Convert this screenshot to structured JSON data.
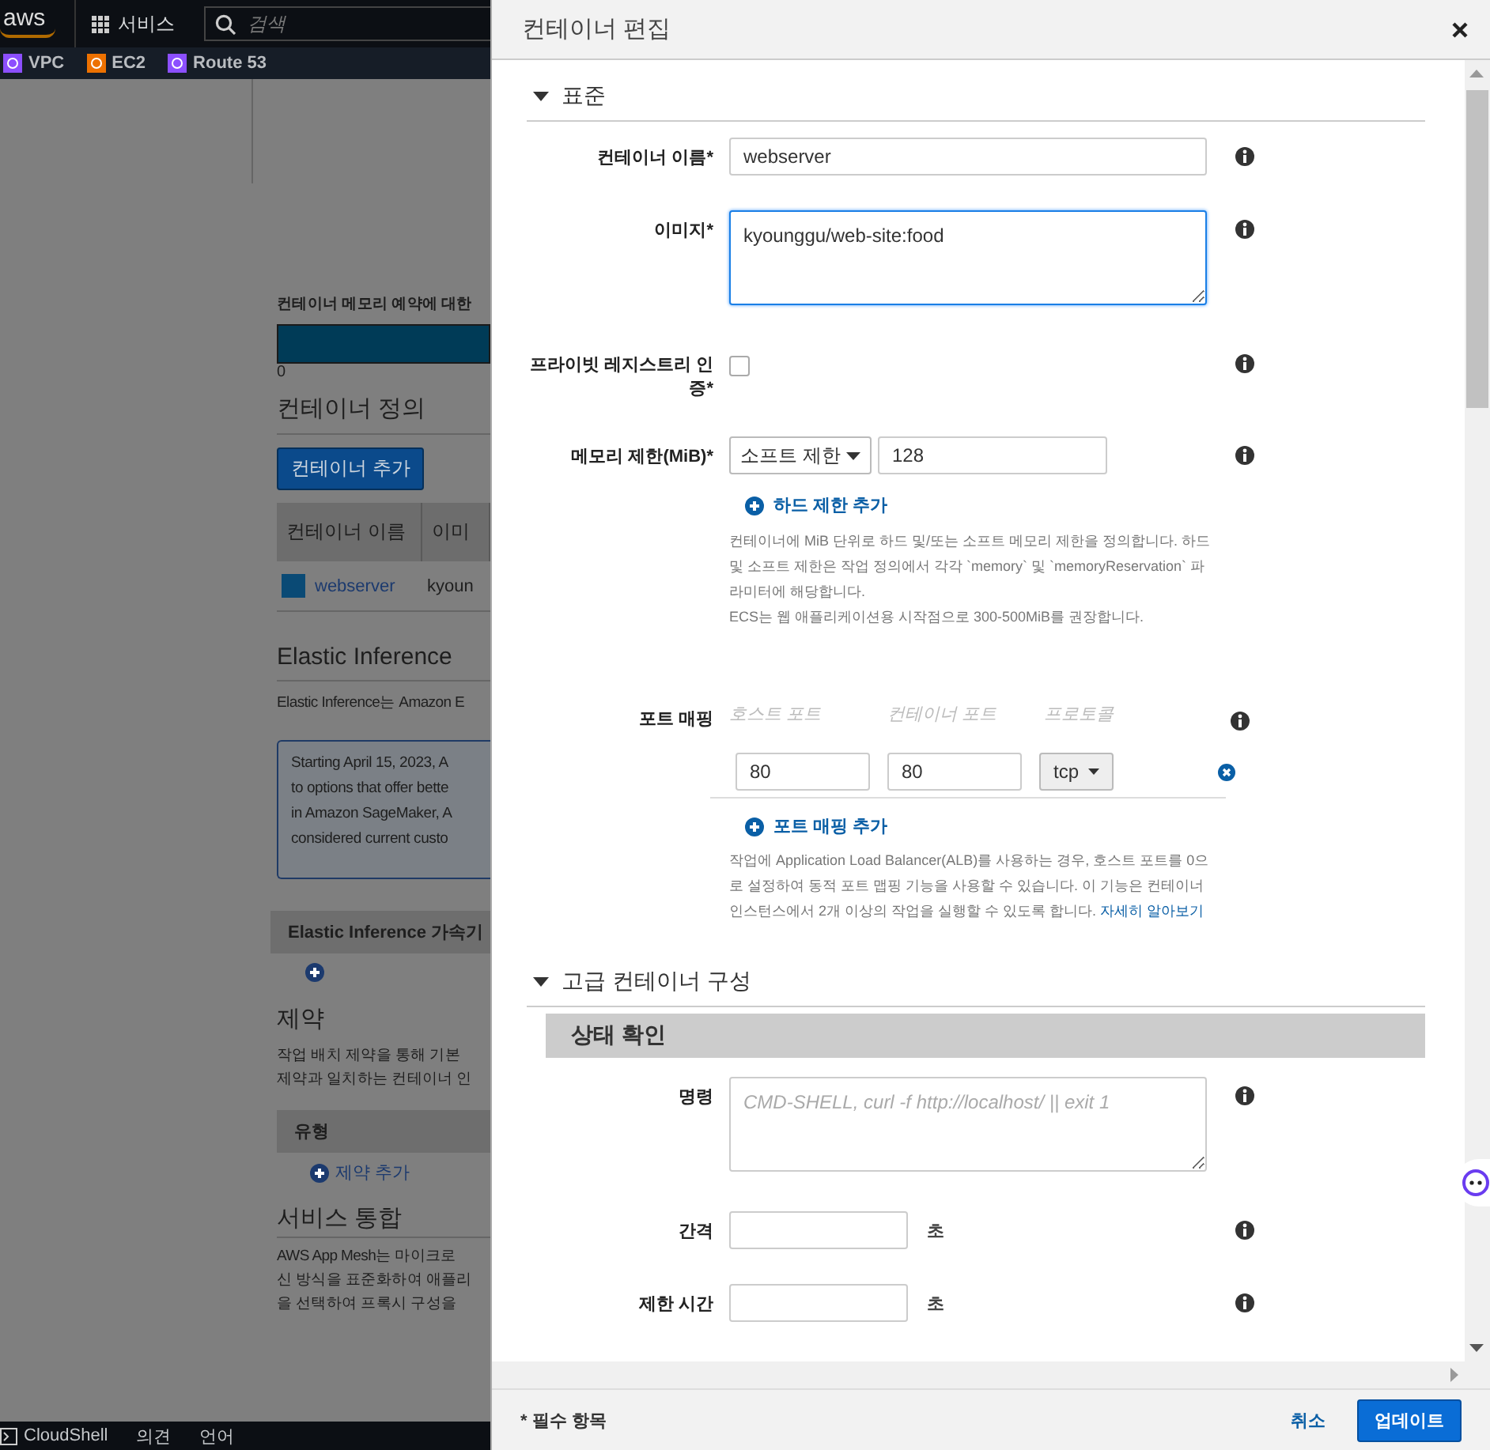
{
  "console": {
    "logo": "aws",
    "services": "서비스",
    "search_placeholder": "검색",
    "favorites": [
      {
        "label": "VPC",
        "color": "#8c4fff"
      },
      {
        "label": "EC2",
        "color": "#ed7100"
      },
      {
        "label": "Route 53",
        "color": "#8c4fff"
      }
    ],
    "memory_title": "컨테이너 메모리 예약에 대한",
    "memory_axis": "0",
    "container_definitions": {
      "title": "컨테이너 정의",
      "add_button": "컨테이너 추가",
      "columns": [
        "컨테이너 이름",
        "이미"
      ],
      "rows": [
        {
          "name": "webserver",
          "image": "kyoun"
        }
      ]
    },
    "elastic_inference": {
      "title": "Elastic Inference",
      "description": "Elastic Inference는 Amazon E",
      "notice": [
        "Starting April 15, 2023, A",
        "to options that offer bette",
        "in Amazon SageMaker, A",
        "considered current custo"
      ],
      "table_header": "Elastic Inference 가속기"
    },
    "constraints": {
      "title": "제약",
      "description": [
        "작업 배치 제약을 통해 기본",
        "제약과 일치하는 컨테이너 인"
      ],
      "column": "유형",
      "add_link": "제약 추가"
    },
    "service_integration": {
      "title": "서비스 통합",
      "description": [
        "AWS App Mesh는 마이크로",
        "신 방식을 표준화하여 애플리",
        "을 선택하여 프록시 구성을"
      ]
    },
    "bottom_bar": [
      "CloudShell",
      "의견",
      "언어"
    ]
  },
  "modal": {
    "title": "컨테이너 편집",
    "sections": [
      {
        "title": "표준",
        "expanded": true,
        "fields": [
          {
            "kind": "text",
            "label": "컨테이너 이름*",
            "value": "webserver"
          },
          {
            "kind": "textarea",
            "label": "이미지*",
            "value": "kyounggu/web-site:food",
            "focused": true
          },
          {
            "kind": "checkbox",
            "label": "프라이빗 레지스트리 인증*",
            "checked": false
          },
          {
            "kind": "memory",
            "label": "메모리 제한(MiB)*",
            "select": "소프트 제한",
            "value": "128",
            "add_link": "하드 제한 추가",
            "help": [
              "컨테이너에 MiB 단위로 하드 및/또는 소프트 메모리 제한을 정의합니다. 하드 및 소프트 제한은 작업 정의에서 각각 `memory` 및 `memoryReservation` 파라미터에 해당합니다.",
              "ECS는 웹 애플리케이션용 시작점으로 300-500MiB를 권장합니다."
            ]
          },
          {
            "kind": "ports",
            "label": "포트 매핑",
            "columns": [
              "호스트 포트",
              "컨테이너 포트",
              "프로토콜"
            ],
            "rows": [
              {
                "host": "80",
                "container": "80",
                "protocol": "tcp"
              }
            ],
            "add_link": "포트 매핑 추가",
            "help": "작업에 Application Load Balancer(ALB)를 사용하는 경우, 호스트 포트를 0으로 설정하여 동적 포트 맵핑 기능을 사용할 수 있습니다. 이 기능은 컨테이너 인스턴스에서 2개 이상의 작업을 실행할 수 있도록 합니다.",
            "help_link": "자세히 알아보기"
          }
        ]
      },
      {
        "title": "고급 컨테이너 구성",
        "expanded": true,
        "subsection": "상태 확인",
        "fields": [
          {
            "kind": "textarea",
            "label": "명령",
            "placeholder": "CMD-SHELL, curl -f http://localhost/ || exit 1",
            "focused": false
          },
          {
            "kind": "number",
            "label": "간격",
            "unit": "초"
          },
          {
            "kind": "number",
            "label": "제한 시간",
            "unit": "초"
          }
        ]
      }
    ],
    "required_note": "* 필수 항목",
    "cancel": "취소",
    "update": "업데이트"
  }
}
